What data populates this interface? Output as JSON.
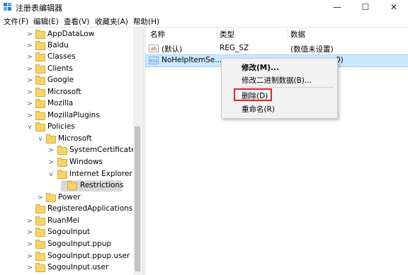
{
  "window": {
    "title": "注册表编辑器",
    "controls": {
      "minimize": "—",
      "maximize": "☐",
      "close": "✕"
    }
  },
  "menubar": [
    "文件(F)",
    "编辑(E)",
    "查看(V)",
    "收藏夹(A)",
    "帮助(H)"
  ],
  "tree": {
    "items": [
      {
        "label": "AppDataLow",
        "chevron": ">"
      },
      {
        "label": "Baidu",
        "chevron": ">"
      },
      {
        "label": "Classes",
        "chevron": ">"
      },
      {
        "label": "Clients",
        "chevron": ">"
      },
      {
        "label": "Google",
        "chevron": ">"
      },
      {
        "label": "Microsoft",
        "chevron": ">"
      },
      {
        "label": "Mozilla",
        "chevron": ">"
      },
      {
        "label": "MozillaPlugins",
        "chevron": ">"
      },
      {
        "label": "Policies",
        "chevron": "v"
      },
      {
        "label": "Microsoft",
        "chevron": "v"
      },
      {
        "label": "SystemCertificates",
        "chevron": ">"
      },
      {
        "label": "Windows",
        "chevron": ">"
      },
      {
        "label": "Internet Explorer",
        "chevron": "v"
      },
      {
        "label": "Restrictions",
        "chevron": ""
      },
      {
        "label": "Power",
        "chevron": ">"
      },
      {
        "label": "RegisteredApplications",
        "chevron": ""
      },
      {
        "label": "RuanMei",
        "chevron": ">"
      },
      {
        "label": "SogouInput",
        "chevron": ">"
      },
      {
        "label": "SogouInput.ppup",
        "chevron": ">"
      },
      {
        "label": "SogouInput.ppup.user",
        "chevron": ">"
      },
      {
        "label": "SogouInput.user",
        "chevron": ">"
      }
    ]
  },
  "list": {
    "columns": [
      "名称",
      "类型",
      "数据"
    ],
    "rows": [
      {
        "icon": "ab",
        "name": "(默认)",
        "type": "REG_SZ",
        "data": "(数值未设置)"
      },
      {
        "icon": "011",
        "name": "NoHelpItemSe...",
        "type": "",
        "data": "0)"
      }
    ]
  },
  "context_menu": {
    "items": [
      "修改(M)...",
      "修改二进制数据(B)...",
      "删除(D)",
      "重命名(R)"
    ],
    "highlight_color": "#e0262a"
  }
}
